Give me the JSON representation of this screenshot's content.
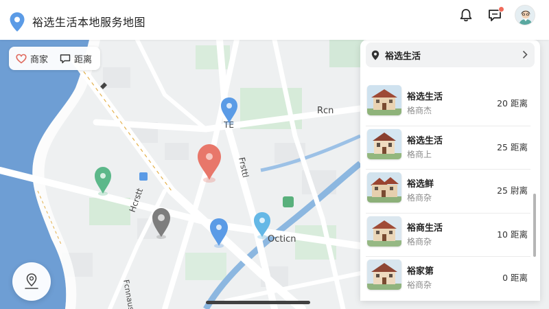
{
  "header": {
    "title": "裕选生活本地服务地图",
    "logo_icon": "location-pin-icon",
    "bell_icon": "bell-icon",
    "message_icon": "message-icon",
    "accent_color": "#5b9be6",
    "notification_color": "#f06a5a"
  },
  "filters": {
    "shop_label": "商家",
    "distance_label": "距离"
  },
  "map": {
    "labels": {
      "road_a": "Rcn",
      "road_b": "TE",
      "road_c": "Octicn",
      "road_d": "Frsttl",
      "road_e": "Hcrstt",
      "road_f": "Fcnnaus"
    },
    "pin_colors": {
      "selected": "#e8776a",
      "blue": "#5b9be6",
      "green": "#5cb88a",
      "gray": "#7d7d7d",
      "light_blue": "#65b8e6"
    }
  },
  "panel": {
    "title": "裕选生活",
    "items": [
      {
        "name": "裕选生活",
        "sub": "格商杰",
        "distance": "20 距离"
      },
      {
        "name": "裕选生活",
        "sub": "格商上",
        "distance": "25 距离"
      },
      {
        "name": "裕选鲜",
        "sub": "格商杂",
        "distance": "25 尉离"
      },
      {
        "name": "裕商生活",
        "sub": "格商杂",
        "distance": "10 距离"
      },
      {
        "name": "裕家第",
        "sub": "裕商杂",
        "distance": "0 距离"
      }
    ]
  }
}
